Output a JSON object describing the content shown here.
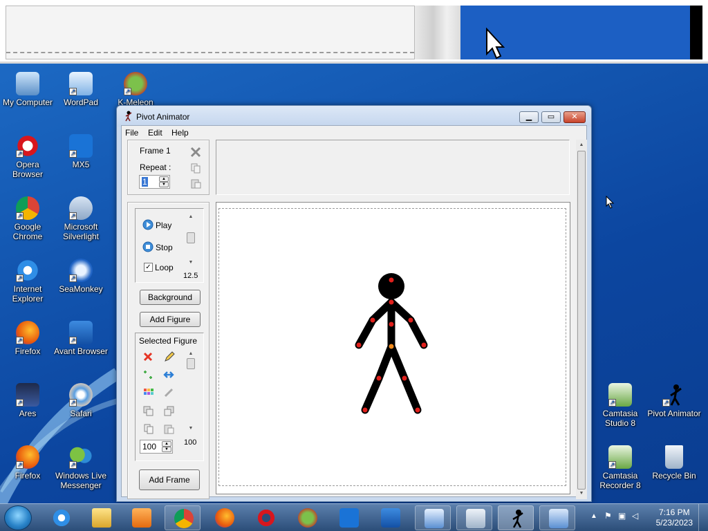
{
  "desktop": {
    "icons": [
      {
        "label": "My Computer"
      },
      {
        "label": "WordPad"
      },
      {
        "label": "K-Meleon"
      },
      {
        "label": "Opera Browser"
      },
      {
        "label": "MX5"
      },
      {
        "label": "Google Chrome"
      },
      {
        "label": "Microsoft Silverlight"
      },
      {
        "label": "Internet Explorer"
      },
      {
        "label": "SeaMonkey"
      },
      {
        "label": "Firefox"
      },
      {
        "label": "Avant Browser"
      },
      {
        "label": "Ares"
      },
      {
        "label": "Safari"
      },
      {
        "label": "Firefox"
      },
      {
        "label": "Windows Live Messenger"
      },
      {
        "label": "Camtasia Studio 8"
      },
      {
        "label": "Pivot Animator"
      },
      {
        "label": "Camtasia Recorder 8"
      },
      {
        "label": "Recycle Bin"
      }
    ]
  },
  "window": {
    "title": "Pivot Animator",
    "menu": {
      "file": "File",
      "edit": "Edit",
      "help": "Help"
    },
    "frame_panel": {
      "frame_label": "Frame 1",
      "repeat_label": "Repeat :",
      "repeat_value": "1"
    },
    "playback": {
      "play": "Play",
      "stop": "Stop",
      "loop": "Loop",
      "loop_checked": true,
      "speed_value": "12.5"
    },
    "buttons": {
      "background": "Background",
      "add_figure": "Add Figure",
      "add_frame": "Add Frame"
    },
    "selected_figure": {
      "label": "Selected Figure",
      "size_value": "100",
      "scale_value": "100"
    }
  },
  "taskbar": {
    "clock_time": "7:16 PM",
    "clock_date": "5/23/2023"
  },
  "colors": {
    "figure": "#000000",
    "joint": "#e0201c",
    "hip_joint": "#f08a1c",
    "desktop_blue": "#1356b0"
  }
}
